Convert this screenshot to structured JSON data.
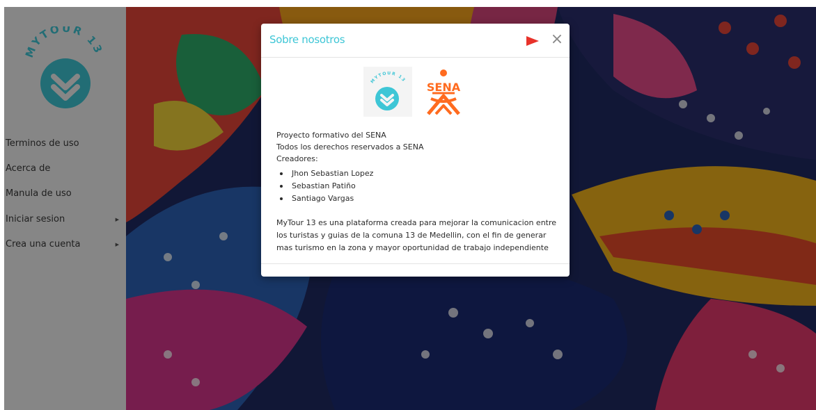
{
  "sidebar": {
    "logo": {
      "text": "MYTOUR 13",
      "color": "#3ec6d6",
      "icon": "chevron-down-double-icon"
    },
    "items": [
      {
        "label": "Terminos de uso",
        "has_submenu": false
      },
      {
        "label": "Acerca de",
        "has_submenu": false
      },
      {
        "label": "Manula de uso",
        "has_submenu": false
      },
      {
        "label": "Iniciar sesion",
        "has_submenu": true
      },
      {
        "label": "Crea una cuenta",
        "has_submenu": true
      }
    ],
    "caret_icon": "caret-right-icon"
  },
  "modal": {
    "title": "Sobre nosotros",
    "play_icon": "play-icon",
    "close_icon": "close-icon",
    "close_glyph": "×",
    "logos": {
      "mytour": "MYTOUR 13",
      "sena": "SENA"
    },
    "line1": "Proyecto formativo del SENA",
    "line2": "Todos los derechos reservados a SENA",
    "creators_label": "Creadores:",
    "creators": [
      "Jhon Sebastian Lopez",
      "Sebastian Patiño",
      "Santiago Vargas"
    ],
    "description_lines": [
      "MyTour 13 es una plataforma creada para mejorar la comunicacion entre",
      "los turistas y guias de la comuna 13 de Medellin, con el fin de generar",
      "mas turismo en la zona y mayor oportunidad de trabajo independiente"
    ]
  },
  "colors": {
    "accent": "#3ec6d6",
    "play": "#e8322a",
    "sena": "#ff6b1f",
    "overlay": "rgba(0,0,0,0.45)"
  }
}
